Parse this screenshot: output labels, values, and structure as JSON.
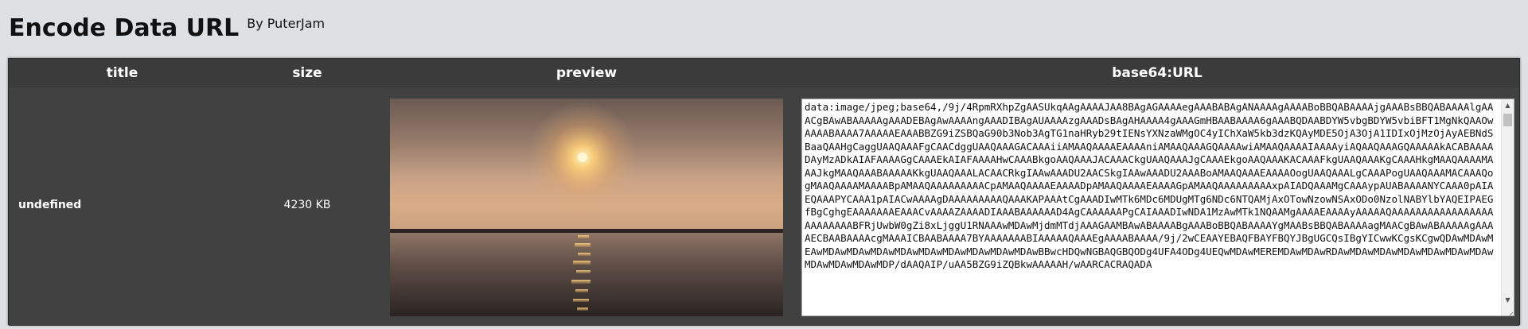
{
  "header": {
    "title": "Encode Data URL",
    "byline": "By PuterJam"
  },
  "table": {
    "columns": {
      "title": "title",
      "size": "size",
      "preview": "preview",
      "base64": "base64:URL"
    },
    "rows": [
      {
        "title": "undefined",
        "size": "4230 KB",
        "preview_description_icon": "sunset-over-water-image",
        "base64_url": "data:image/jpeg;base64,/9j/4RpmRXhpZgAASUkqAAgAAAAJAA8BAgAGAAAAegAAABABAgANAAAAgAAAABoBBQABAAAAjgAAABsBBQABAAAAlgAAACgBAwABAAAAAgAAADEBAgAwAAAAngAAADIBAgAUAAAAzgAAADsBAgAHAAAA4gAAAGmHBAABAAAA6gAAABQDAABDYW5vbgBDYW5vbiBFT1MgNkQAAOwAAAABAAAA7AAAAAEAAABBZG9iZSBQaG90b3Nob3AgTG1naHRyb29tIENsYXNzaWMgOC4yIChXaW5kb3dzKQAyMDE5OjA3OjA1IDIxOjMzOjAyAEBNdSBaaQAAHgCaggUAAQAAAFgCAACdggUAAQAAAGACAAAiiAMAAQAAAAEAAAAniAMAAQAAAGQAAAAwiAMAAQAAAAIAAAAyiAQAAQAAAGQAAAAAkACABAAAADAyMzADkAIAFAAAAGgCAAAEkAIAFAAAAHwCAAABkgoAAQAAAJACAAACkgUAAQAAAJgCAAAEkgoAAQAAAKACAAAFkgUAAQAAAKgCAAAHkgMAAQAAAAMAAAJkgMAAQAAABAAAAAKkgUAAQAAALACAACRkgIAAwAAADU2AACSkgIAAwAAADU2AAABoAMAAQAAAEAAAAOogUAAQAAALgCAAAPogUAAQAAAMACAAAQogMAAQAAAAMAAAABpAMAAQAAAAAAAAACpAMAAQAAAAEAAAADpAMAAQAAAAEAAAAGpAMAAQAAAAAAAAAxpAIADQAAAMgCAAAypAUABAAAANYCAAA0pAIAEQAAAPYCAAA1pAIACwAAAAgDAAAAAAAAAQAAAKAPAAAtCgAAADIwMTk6MDc6MDUgMTg6NDc6NTQAMjAxOTowNzowNSAxODo0NzolNABYlbYAQEIPAEGfBgCghgEAAAAAAAEAAACvAAAAZAAAADIAAABAAAAAAD4AgCAAAAAAPgCAIAAADIwNDA1MzAwMTk1NQAAMgAAAAEAAAAyAAAAAQAAAAAAAAAAAAAAAAAAAAAAAAABFRjUwbW0gZi8xLjggU1RNAAAwMDAwMjdmMTdjAAAGAAMBAwABAAAABgAAABoBBQABAAAAYgMAABsBBQABAAAAagMAACgBAwABAAAAAgAAAAECBAABAAAAcgMAAAICBAABAAAA7BYAAAAAAABIAAAAAQAAAEgAAAABAAAA/9j/2wCEAAYEBAQFBAYFBQYJBgUGCQsIBgYICwwKCgsKCgwQDAwMDAwMEAwMDAwMDAwMDAwMDAwMDAwMDAwMDAwMDAwMDAwBBwcHDQwNGBAQGBQODg4UFA4ODg4UEQwMDAwMEREMDAwMDAwRDAwMDAwMDAwMDAwMDAwMDAwMDAwMDAwMDAwMDAwMDP/dAAQAIP/uAA5BZG9iZQBkwAAAAAH/wAARCACRAQADA"
      }
    ]
  },
  "colors": {
    "page_bg": "#dde1e3",
    "panel_bg": "#3a3b3a",
    "row_bg": "#404140",
    "header_text": "#ffffff"
  }
}
